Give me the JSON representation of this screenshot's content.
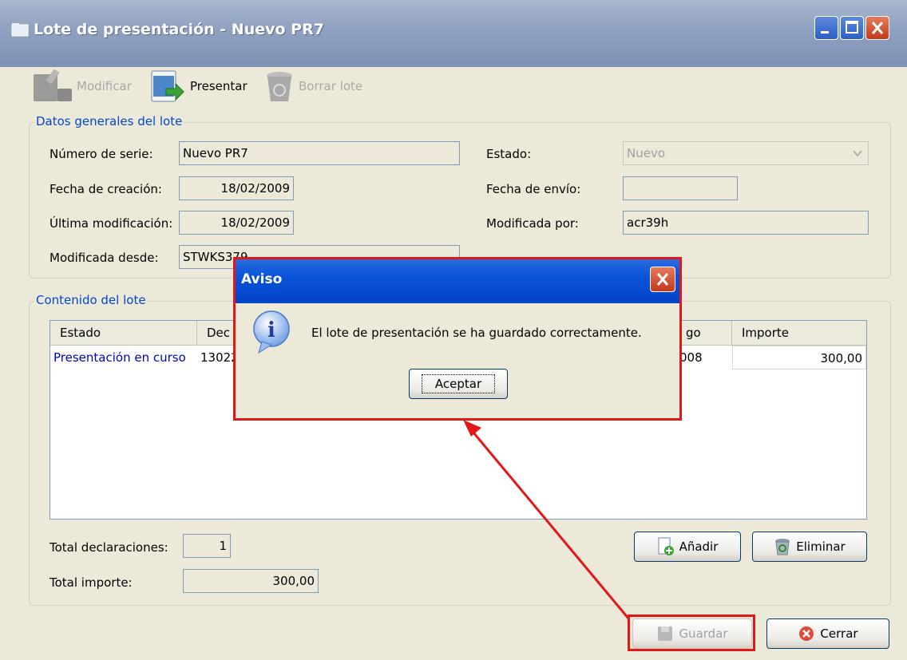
{
  "window": {
    "title": "Lote de presentación  - Nuevo PR7"
  },
  "toolbar": {
    "modificar": "Modificar",
    "presentar": "Presentar",
    "borrar": "Borrar lote"
  },
  "general": {
    "legend": "Datos generales del lote",
    "numero_serie_label": "Número de serie:",
    "numero_serie_value": "Nuevo PR7",
    "fecha_creacion_label": "Fecha de creación:",
    "fecha_creacion_value": "18/02/2009",
    "ultima_mod_label": "Última modificación:",
    "ultima_mod_value": "18/02/2009",
    "mod_desde_label": "Modificada desde:",
    "mod_desde_value": "STWKS379",
    "estado_label": "Estado:",
    "estado_value": "Nuevo",
    "fecha_envio_label": "Fecha de envío:",
    "fecha_envio_value": "",
    "mod_por_label": "Modificada por:",
    "mod_por_value": "acr39h"
  },
  "contenido": {
    "legend": "Contenido del lote",
    "columns": {
      "estado": "Estado",
      "dec": "Dec",
      "go": "go",
      "importe": "Importe"
    },
    "rows": [
      {
        "estado": "Presentación en curso",
        "dec": "13022",
        "go": "008",
        "importe": "300,00"
      }
    ],
    "total_decl_label": "Total declaraciones:",
    "total_decl_value": "1",
    "total_imp_label": "Total importe:",
    "total_imp_value": "300,00",
    "anadir": "Añadir",
    "eliminar": "Eliminar"
  },
  "footer": {
    "guardar": "Guardar",
    "cerrar": "Cerrar"
  },
  "dialog": {
    "title": "Aviso",
    "message": "El lote de presentación se ha guardado correctamente.",
    "ok": "Aceptar"
  },
  "colors": {
    "annotation_red": "#e01818",
    "xp_blue": "#0046d5"
  }
}
